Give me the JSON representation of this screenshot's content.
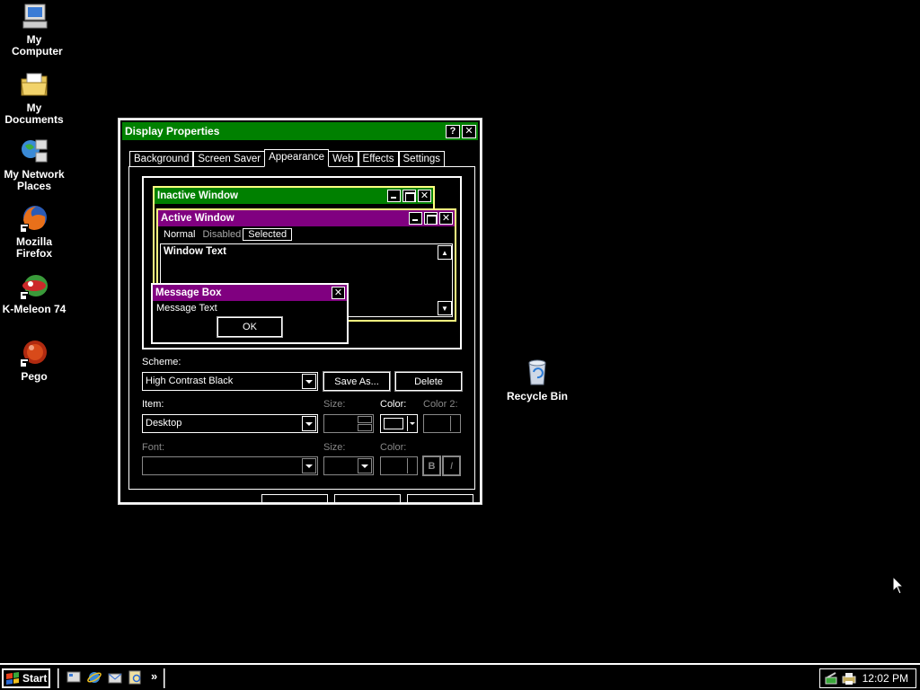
{
  "desktop": {
    "icons": [
      {
        "label": "My Computer",
        "icon": "my-computer-icon"
      },
      {
        "label": "My Documents",
        "icon": "my-documents-icon"
      },
      {
        "label": "My Network Places",
        "icon": "network-places-icon"
      },
      {
        "label": "Mozilla Firefox",
        "icon": "firefox-icon"
      },
      {
        "label": "K-Meleon 74",
        "icon": "kmeleon-icon"
      },
      {
        "label": "Pego",
        "icon": "pego-icon"
      }
    ],
    "recycle_bin": "Recycle Bin"
  },
  "dialog": {
    "title": "Display Properties",
    "help": "?",
    "close": "✕",
    "tabs": [
      "Background",
      "Screen Saver",
      "Appearance",
      "Web",
      "Effects",
      "Settings"
    ],
    "active_tab": "Appearance",
    "preview": {
      "inactive_title": "Inactive Window",
      "active_title": "Active Window",
      "menu_normal": "Normal",
      "menu_disabled": "Disabled",
      "menu_selected": "Selected",
      "window_text": "Window Text",
      "msgbox_title": "Message Box",
      "msgbox_text": "Message Text",
      "ok": "OK"
    },
    "scheme_label": "Scheme:",
    "scheme_value": "High Contrast Black",
    "save_as": "Save As...",
    "delete": "Delete",
    "item_label": "Item:",
    "item_value": "Desktop",
    "size_label": "Size:",
    "color_label": "Color:",
    "color2_label": "Color 2:",
    "font_label": "Font:",
    "font_size_label": "Size:",
    "font_color_label": "Color:",
    "bold": "B",
    "italic": "I"
  },
  "taskbar": {
    "start": "Start",
    "chevron": "»",
    "clock": "12:02 PM"
  },
  "colors": {
    "active_title": "#800080",
    "inactive_title": "#008000",
    "dialog_title": "#008000",
    "background": "#000000"
  }
}
